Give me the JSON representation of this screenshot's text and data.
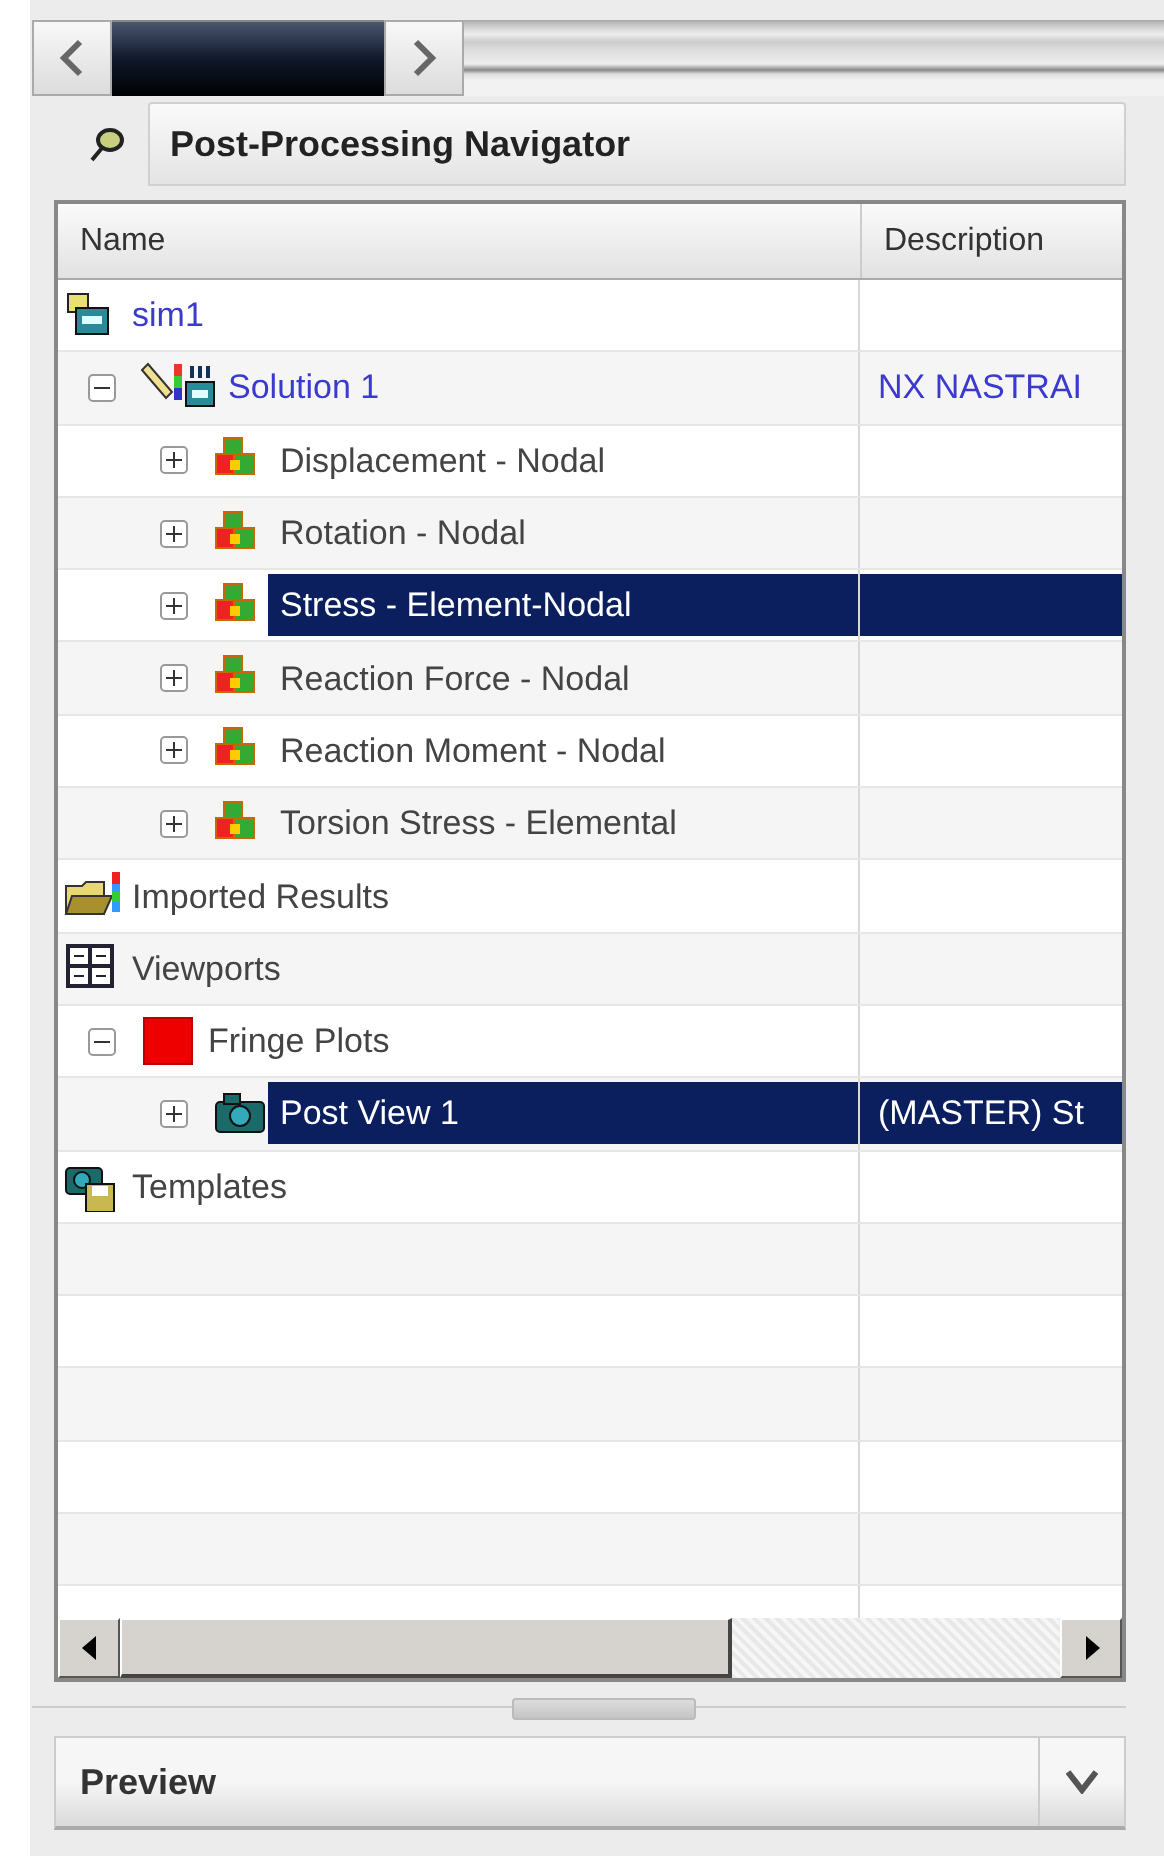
{
  "navigator": {
    "title": "Post-Processing Navigator"
  },
  "table": {
    "columns": [
      "Name",
      "Description"
    ],
    "tree": [
      {
        "kind": "model",
        "name": "sim1",
        "selected": false,
        "children": [
          {
            "kind": "solution",
            "name": "Solution 1",
            "description": "NX NASTRAI",
            "expanded": true,
            "selected": false,
            "children": [
              {
                "kind": "result",
                "name": "Displacement - Nodal",
                "expanded": false,
                "selected": false
              },
              {
                "kind": "result",
                "name": "Rotation - Nodal",
                "expanded": false,
                "selected": false
              },
              {
                "kind": "result",
                "name": "Stress - Element-Nodal",
                "expanded": false,
                "selected": true
              },
              {
                "kind": "result",
                "name": "Reaction Force - Nodal",
                "expanded": false,
                "selected": false
              },
              {
                "kind": "result",
                "name": "Reaction Moment - Nodal",
                "expanded": false,
                "selected": false
              },
              {
                "kind": "result",
                "name": "Torsion Stress - Elemental",
                "expanded": false,
                "selected": false
              }
            ]
          }
        ]
      },
      {
        "kind": "imported",
        "name": "Imported Results",
        "selected": false
      },
      {
        "kind": "viewports",
        "name": "Viewports",
        "selected": false,
        "children": [
          {
            "kind": "fringe",
            "name": "Fringe Plots",
            "expanded": true,
            "selected": false,
            "children": [
              {
                "kind": "view",
                "name": "Post View 1",
                "description": "(MASTER) St",
                "expanded": false,
                "selected": true
              }
            ]
          }
        ]
      },
      {
        "kind": "templates",
        "name": "Templates",
        "selected": false
      }
    ]
  },
  "preview": {
    "title": "Preview"
  }
}
